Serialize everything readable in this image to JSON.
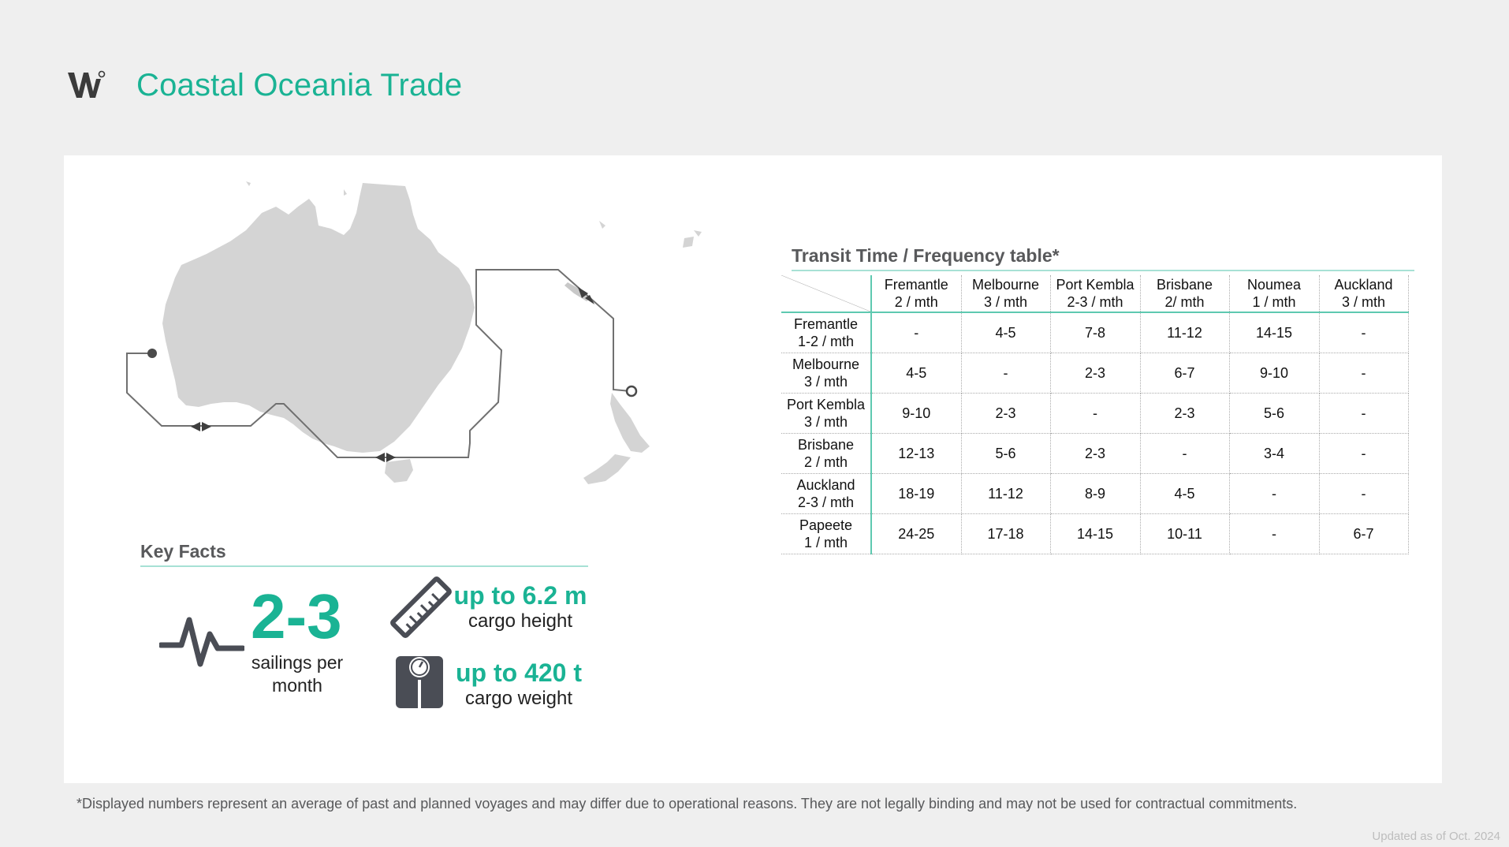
{
  "title": "Coastal Oceania Trade",
  "colors": {
    "accent": "#1ab394",
    "heading_gray": "#58595b",
    "land": "#d4d4d4"
  },
  "key_facts": {
    "heading": "Key Facts",
    "sailings_value": "2-3",
    "sailings_label": "sailings per month",
    "height_value": "up to 6.2 m",
    "height_label": "cargo height",
    "weight_value": "up to 420 t",
    "weight_label": "cargo weight",
    "icons": [
      "pulse-icon",
      "ruler-icon",
      "scale-icon"
    ]
  },
  "table": {
    "title": "Transit Time / Frequency table*",
    "columns": [
      {
        "name": "Fremantle",
        "freq": "2 / mth"
      },
      {
        "name": "Melbourne",
        "freq": "3 / mth"
      },
      {
        "name": "Port Kembla",
        "freq": "2-3 / mth"
      },
      {
        "name": "Brisbane",
        "freq": "2/ mth"
      },
      {
        "name": "Noumea",
        "freq": "1 / mth"
      },
      {
        "name": "Auckland",
        "freq": "3 / mth"
      }
    ],
    "rows": [
      {
        "name": "Fremantle",
        "freq": "1-2 / mth",
        "cells": [
          "-",
          "4-5",
          "7-8",
          "11-12",
          "14-15",
          "-"
        ]
      },
      {
        "name": "Melbourne",
        "freq": "3 / mth",
        "cells": [
          "4-5",
          "-",
          "2-3",
          "6-7",
          "9-10",
          "-"
        ]
      },
      {
        "name": "Port Kembla",
        "freq": "3 / mth",
        "cells": [
          "9-10",
          "2-3",
          "-",
          "2-3",
          "5-6",
          "-"
        ]
      },
      {
        "name": "Brisbane",
        "freq": "2 / mth",
        "cells": [
          "12-13",
          "5-6",
          "2-3",
          "-",
          "3-4",
          "-"
        ]
      },
      {
        "name": "Auckland",
        "freq": "2-3 / mth",
        "cells": [
          "18-19",
          "11-12",
          "8-9",
          "4-5",
          "-",
          "-"
        ]
      },
      {
        "name": "Papeete",
        "freq": "1 / mth",
        "cells": [
          "24-25",
          "17-18",
          "14-15",
          "10-11",
          "-",
          "6-7"
        ]
      }
    ]
  },
  "footnote": "*Displayed numbers represent an average of past and planned voyages and may differ due to operational reasons. They are not legally binding and may not be used for contractual commitments.",
  "updated": "Updated as of Oct. 2024"
}
